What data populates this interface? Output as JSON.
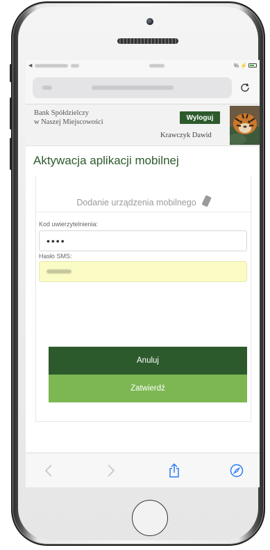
{
  "status_bar": {
    "carrier_left": "",
    "time": "",
    "battery_pct": "%"
  },
  "browser": {
    "url": ""
  },
  "header": {
    "bank_line1": "Bank Spółdzielczy",
    "bank_line2": "w Naszej Miejscowości",
    "logout_label": "Wyloguj",
    "user_name": "Krawczyk Dawid"
  },
  "page": {
    "title": "Aktywacja aplikacji mobilnej"
  },
  "form": {
    "subtitle": "Dodanie urządzenia mobilnego",
    "code_label": "Kod uwierzytelnienia:",
    "code_value": "••••",
    "sms_label": "Hasło SMS:",
    "sms_value": "",
    "cancel_label": "Anuluj",
    "confirm_label": "Zatwierdź"
  },
  "colors": {
    "primary_green": "#2d5a2d",
    "light_green": "#7cb752",
    "sms_field_bg": "#fbfbc5",
    "ios_blue": "#2a7cf6"
  },
  "toolbar_icons": [
    "back-icon",
    "forward-icon",
    "share-icon",
    "compass-icon"
  ]
}
